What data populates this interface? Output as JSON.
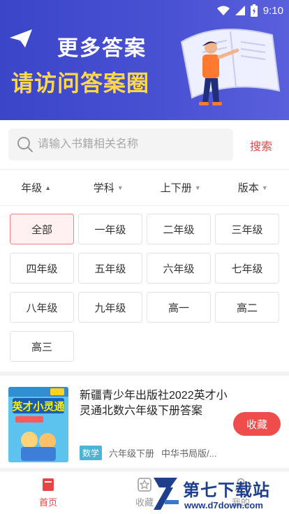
{
  "status_bar": {
    "time": "9:10"
  },
  "banner": {
    "line1": "更多答案",
    "line2": "请访问答案圈"
  },
  "search": {
    "placeholder": "请输入书籍相关名称",
    "button_label": "搜索"
  },
  "filters": [
    {
      "label": "年级",
      "caret": "▲"
    },
    {
      "label": "学科",
      "caret": "▼"
    },
    {
      "label": "上下册",
      "caret": "▼"
    },
    {
      "label": "版本",
      "caret": "▼"
    }
  ],
  "grades": [
    "全部",
    "一年级",
    "二年级",
    "三年级",
    "四年级",
    "五年级",
    "六年级",
    "七年级",
    "八年级",
    "九年级",
    "高一",
    "高二",
    "高三"
  ],
  "selected_grade": "全部",
  "book": {
    "title": "新疆青少年出版社2022英才小灵通北数六年级下册答案",
    "subject_tag": "数学",
    "grade": "六年级下册",
    "publisher": "中华书局版/...",
    "collect_label": "收藏",
    "cover_title": "英才小灵通"
  },
  "bottom_nav": [
    {
      "label": "首页",
      "icon": "book-icon",
      "active": true
    },
    {
      "label": "收藏",
      "icon": "star-icon",
      "active": false
    },
    {
      "label": "我的",
      "icon": "user-icon",
      "active": false
    }
  ],
  "watermark": {
    "name": "第七下载站",
    "url": "www.d7down.com"
  },
  "colors": {
    "accent": "#e64545",
    "banner": "#3b45c7",
    "banner_highlight": "#ffd84a",
    "tag": "#4db4d8"
  }
}
